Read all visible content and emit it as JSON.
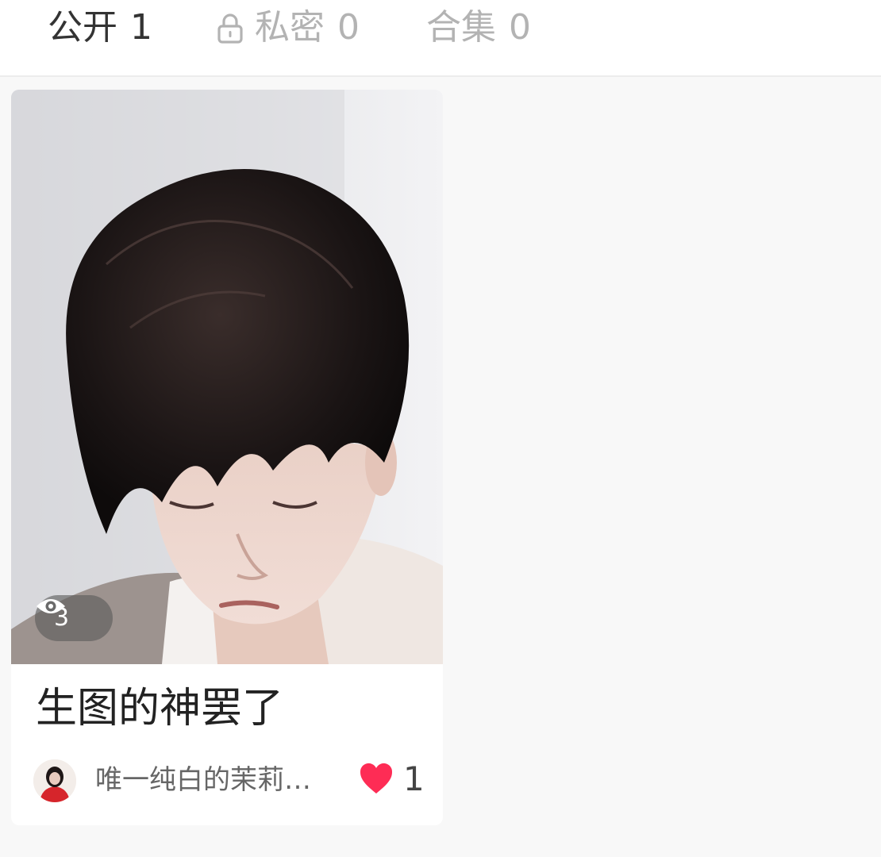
{
  "tabs": [
    {
      "label": "公开",
      "count": "1",
      "active": true
    },
    {
      "label": "私密",
      "count": "0",
      "active": false,
      "icon": "lock-icon"
    },
    {
      "label": "合集",
      "count": "0",
      "active": false
    }
  ],
  "posts": [
    {
      "cover": "photo",
      "views": "3",
      "view_icon": "eye-icon",
      "title": "生图的神罢了",
      "author": "唯一纯白的茉莉…",
      "likes": "1",
      "like_icon": "heart-icon"
    }
  ],
  "colors": {
    "like": "#fe2c55",
    "active_tab": "#333333",
    "inactive_tab": "#b3b3b3",
    "background": "#f8f8f8"
  }
}
